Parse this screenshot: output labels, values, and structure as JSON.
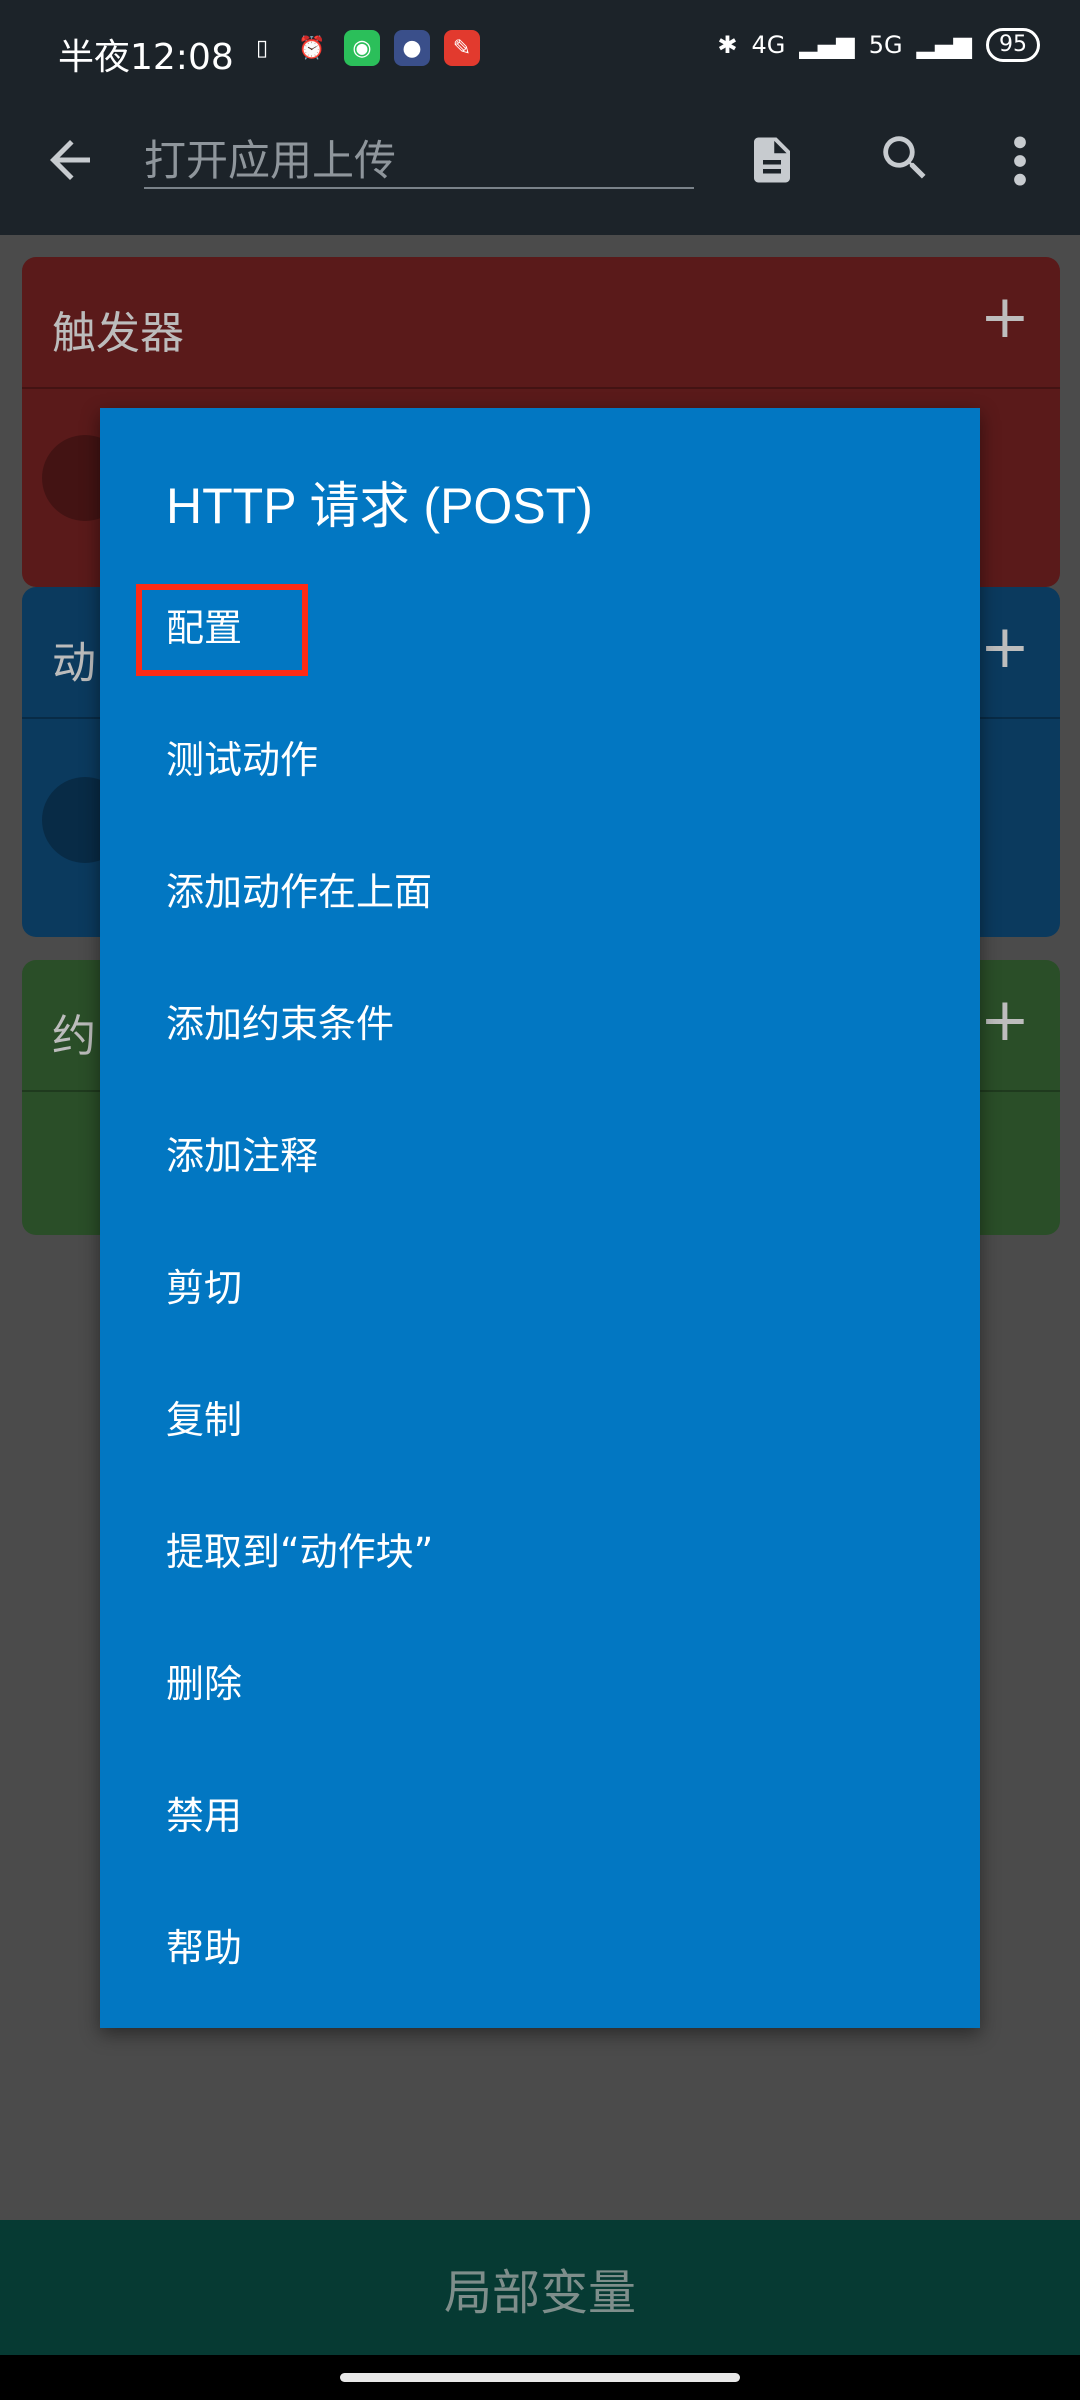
{
  "status_bar": {
    "time": "半夜12:08",
    "battery": "95",
    "network_1": "4G",
    "network_2": "5G"
  },
  "app_bar": {
    "title_value": "打开应用上传",
    "back_icon": "arrow-left-icon",
    "doc_icon": "document-icon",
    "search_icon": "search-icon",
    "more_icon": "more-vert-icon"
  },
  "cards": {
    "trigger_title": "触发器",
    "action_title": "动",
    "constraint_title": "约",
    "plus": "+"
  },
  "menu": {
    "title": "HTTP 请求 (POST)",
    "items": [
      {
        "label": "配置"
      },
      {
        "label": "测试动作"
      },
      {
        "label": "添加动作在上面"
      },
      {
        "label": "添加约束条件"
      },
      {
        "label": "添加注释"
      },
      {
        "label": "剪切"
      },
      {
        "label": "复制"
      },
      {
        "label": "提取到“动作块”"
      },
      {
        "label": "删除"
      },
      {
        "label": "禁用"
      },
      {
        "label": "帮助"
      }
    ]
  },
  "bottom_bar": {
    "label": "局部变量"
  },
  "colors": {
    "menu_bg": "#0277c2",
    "highlight": "#ff2a14",
    "trigger": "#5a1a1a",
    "action": "#0b3a5e",
    "constraint": "#2a4e28"
  }
}
